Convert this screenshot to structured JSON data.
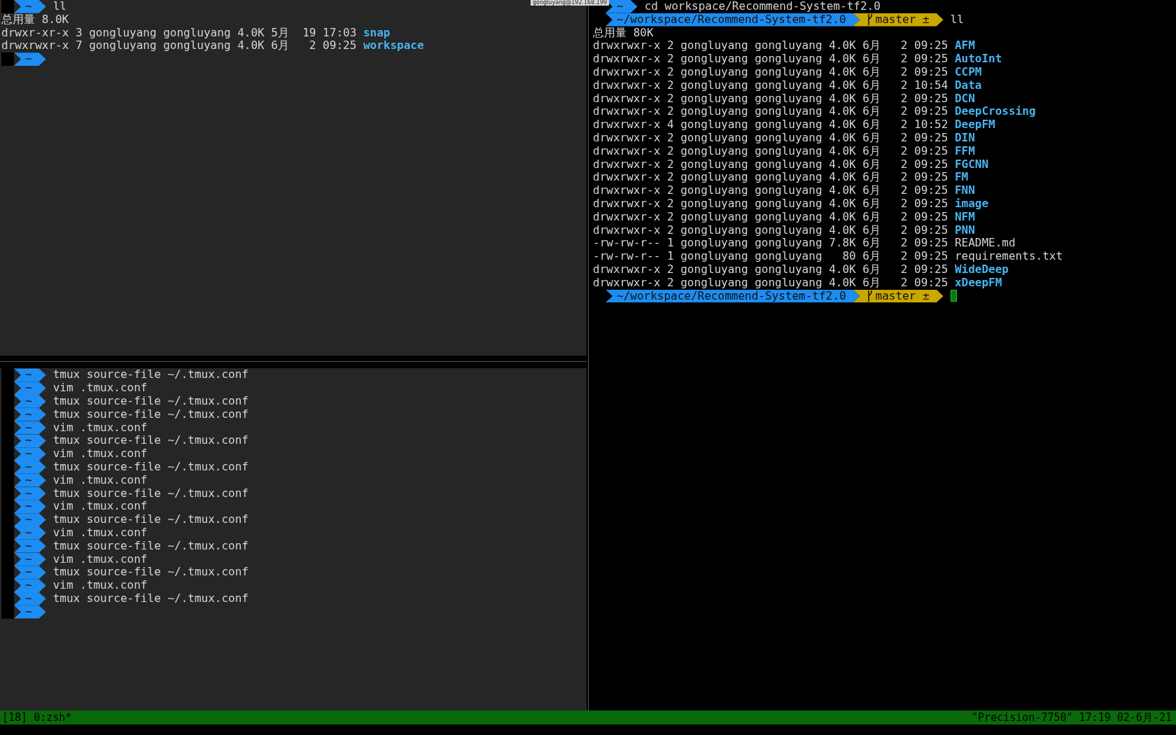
{
  "overlay_label": "gongluyang@192.168.199",
  "panes": {
    "top_left": {
      "lines": [
        {
          "kind": "prompt",
          "path": "~",
          "command": "ll",
          "cursor": false
        },
        {
          "kind": "output",
          "text": "总用量 8.0K"
        },
        {
          "kind": "entry",
          "info": "drwxr-xr-x 3 gongluyang gongluyang 4.0K 5月  19 17:03",
          "name": "snap",
          "dir": true
        },
        {
          "kind": "entry",
          "info": "drwxrwxr-x 7 gongluyang gongluyang 4.0K 6月   2 09:25",
          "name": "workspace",
          "dir": true
        },
        {
          "kind": "prompt",
          "path": "~",
          "cursor": false
        }
      ]
    },
    "bottom_left": {
      "lines": [
        {
          "kind": "prompt",
          "path": "~",
          "command": "tmux source-file ~/.tmux.conf",
          "cursor": false
        },
        {
          "kind": "prompt",
          "path": "~",
          "command": "vim .tmux.conf",
          "cursor": false
        },
        {
          "kind": "prompt",
          "path": "~",
          "command": "tmux source-file ~/.tmux.conf",
          "cursor": false
        },
        {
          "kind": "prompt",
          "path": "~",
          "command": "tmux source-file ~/.tmux.conf",
          "cursor": false
        },
        {
          "kind": "prompt",
          "path": "~",
          "command": "vim .tmux.conf",
          "cursor": false
        },
        {
          "kind": "prompt",
          "path": "~",
          "command": "tmux source-file ~/.tmux.conf",
          "cursor": false
        },
        {
          "kind": "prompt",
          "path": "~",
          "command": "vim .tmux.conf",
          "cursor": false
        },
        {
          "kind": "prompt",
          "path": "~",
          "command": "tmux source-file ~/.tmux.conf",
          "cursor": false
        },
        {
          "kind": "prompt",
          "path": "~",
          "command": "vim .tmux.conf",
          "cursor": false
        },
        {
          "kind": "prompt",
          "path": "~",
          "command": "tmux source-file ~/.tmux.conf",
          "cursor": false
        },
        {
          "kind": "prompt",
          "path": "~",
          "command": "vim .tmux.conf",
          "cursor": false
        },
        {
          "kind": "prompt",
          "path": "~",
          "command": "tmux source-file ~/.tmux.conf",
          "cursor": false
        },
        {
          "kind": "prompt",
          "path": "~",
          "command": "vim .tmux.conf",
          "cursor": false
        },
        {
          "kind": "prompt",
          "path": "~",
          "command": "tmux source-file ~/.tmux.conf",
          "cursor": false
        },
        {
          "kind": "prompt",
          "path": "~",
          "command": "vim .tmux.conf",
          "cursor": false
        },
        {
          "kind": "prompt",
          "path": "~",
          "command": "tmux source-file ~/.tmux.conf",
          "cursor": false
        },
        {
          "kind": "prompt",
          "path": "~",
          "command": "vim .tmux.conf",
          "cursor": false
        },
        {
          "kind": "prompt",
          "path": "~",
          "command": "tmux source-file ~/.tmux.conf",
          "cursor": false
        },
        {
          "kind": "prompt",
          "path": "~",
          "cursor": false
        }
      ]
    },
    "right": {
      "lines": [
        {
          "kind": "prompt",
          "path": "~",
          "command": "cd workspace/Recommend-System-tf2.0",
          "cursor": false
        },
        {
          "kind": "prompt",
          "path": "~/workspace/Recommend-System-tf2.0",
          "branch": "master ±",
          "command": "ll",
          "cursor": false
        },
        {
          "kind": "output",
          "text": "总用量 80K"
        },
        {
          "kind": "entry",
          "info": "drwxrwxr-x 2 gongluyang gongluyang 4.0K 6月   2 09:25",
          "name": "AFM",
          "dir": true
        },
        {
          "kind": "entry",
          "info": "drwxrwxr-x 2 gongluyang gongluyang 4.0K 6月   2 09:25",
          "name": "AutoInt",
          "dir": true
        },
        {
          "kind": "entry",
          "info": "drwxrwxr-x 2 gongluyang gongluyang 4.0K 6月   2 09:25",
          "name": "CCPM",
          "dir": true
        },
        {
          "kind": "entry",
          "info": "drwxrwxr-x 2 gongluyang gongluyang 4.0K 6月   2 10:54",
          "name": "Data",
          "dir": true
        },
        {
          "kind": "entry",
          "info": "drwxrwxr-x 2 gongluyang gongluyang 4.0K 6月   2 09:25",
          "name": "DCN",
          "dir": true
        },
        {
          "kind": "entry",
          "info": "drwxrwxr-x 2 gongluyang gongluyang 4.0K 6月   2 09:25",
          "name": "DeepCrossing",
          "dir": true
        },
        {
          "kind": "entry",
          "info": "drwxrwxr-x 4 gongluyang gongluyang 4.0K 6月   2 10:52",
          "name": "DeepFM",
          "dir": true
        },
        {
          "kind": "entry",
          "info": "drwxrwxr-x 2 gongluyang gongluyang 4.0K 6月   2 09:25",
          "name": "DIN",
          "dir": true
        },
        {
          "kind": "entry",
          "info": "drwxrwxr-x 2 gongluyang gongluyang 4.0K 6月   2 09:25",
          "name": "FFM",
          "dir": true
        },
        {
          "kind": "entry",
          "info": "drwxrwxr-x 2 gongluyang gongluyang 4.0K 6月   2 09:25",
          "name": "FGCNN",
          "dir": true
        },
        {
          "kind": "entry",
          "info": "drwxrwxr-x 2 gongluyang gongluyang 4.0K 6月   2 09:25",
          "name": "FM",
          "dir": true
        },
        {
          "kind": "entry",
          "info": "drwxrwxr-x 2 gongluyang gongluyang 4.0K 6月   2 09:25",
          "name": "FNN",
          "dir": true
        },
        {
          "kind": "entry",
          "info": "drwxrwxr-x 2 gongluyang gongluyang 4.0K 6月   2 09:25",
          "name": "image",
          "dir": true
        },
        {
          "kind": "entry",
          "info": "drwxrwxr-x 2 gongluyang gongluyang 4.0K 6月   2 09:25",
          "name": "NFM",
          "dir": true
        },
        {
          "kind": "entry",
          "info": "drwxrwxr-x 2 gongluyang gongluyang 4.0K 6月   2 09:25",
          "name": "PNN",
          "dir": true
        },
        {
          "kind": "entry",
          "info": "-rw-rw-r-- 1 gongluyang gongluyang 7.8K 6月   2 09:25",
          "name": "README.md",
          "dir": false
        },
        {
          "kind": "entry",
          "info": "-rw-rw-r-- 1 gongluyang gongluyang   80 6月   2 09:25",
          "name": "requirements.txt",
          "dir": false
        },
        {
          "kind": "entry",
          "info": "drwxrwxr-x 2 gongluyang gongluyang 4.0K 6月   2 09:25",
          "name": "WideDeep",
          "dir": true
        },
        {
          "kind": "entry",
          "info": "drwxrwxr-x 2 gongluyang gongluyang 4.0K 6月   2 09:25",
          "name": "xDeepFM",
          "dir": true
        },
        {
          "kind": "prompt",
          "path": "~/workspace/Recommend-System-tf2.0",
          "branch": "master ±",
          "cursor": true
        }
      ]
    }
  },
  "status_bar": {
    "left": "[18] 0:zsh*",
    "right": "\"Precision-7750\" 17:19 02-6月-21"
  }
}
